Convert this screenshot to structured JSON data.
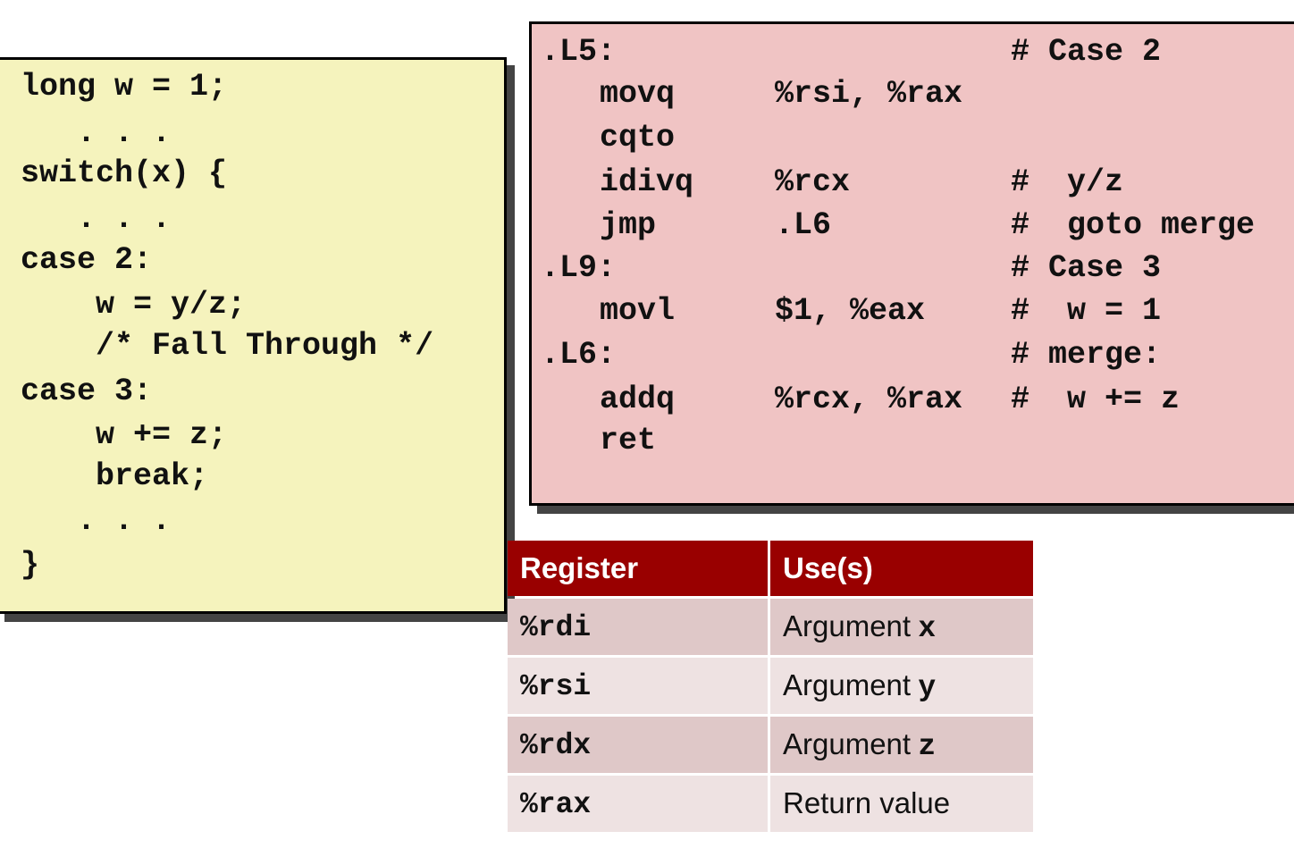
{
  "c_code": {
    "lines": [
      "long w = 1;",
      "   . . .",
      "switch(x) {",
      "   . . .",
      "case 2:",
      "    w = y/z;",
      "    /* Fall Through */",
      "case 3:",
      "    w += z;",
      "    break;",
      "   . . .",
      "}"
    ]
  },
  "assembly": {
    "lines": [
      {
        "label": ".L5:",
        "op": "",
        "args": "",
        "comment": "# Case 2"
      },
      {
        "label": "",
        "op": "movq",
        "args": "%rsi, %rax",
        "comment": ""
      },
      {
        "label": "",
        "op": "cqto",
        "args": "",
        "comment": ""
      },
      {
        "label": "",
        "op": "idivq",
        "args": "%rcx",
        "comment": "#  y/z"
      },
      {
        "label": "",
        "op": "jmp",
        "args": ".L6",
        "comment": "#  goto merge"
      },
      {
        "label": ".L9:",
        "op": "",
        "args": "",
        "comment": "# Case 3"
      },
      {
        "label": "",
        "op": "movl",
        "args": "$1, %eax",
        "comment": "#  w = 1"
      },
      {
        "label": ".L6:",
        "op": "",
        "args": "",
        "comment": "# merge:"
      },
      {
        "label": "",
        "op": "addq",
        "args": "%rcx, %rax",
        "comment": "#  w += z"
      },
      {
        "label": "",
        "op": "ret",
        "args": "",
        "comment": ""
      }
    ]
  },
  "register_table": {
    "headers": [
      "Register",
      "Use(s)"
    ],
    "rows": [
      {
        "register": "%rdi",
        "use": "Argument",
        "var": "x"
      },
      {
        "register": "%rsi",
        "use": "Argument",
        "var": "y"
      },
      {
        "register": "%rdx",
        "use": "Argument",
        "var": "z"
      },
      {
        "register": "%rax",
        "use": "Return value",
        "var": ""
      }
    ]
  },
  "colors": {
    "c_box_bg": "#f5f3bd",
    "asm_box_bg": "#f0c4c4",
    "table_header_bg": "#990000",
    "table_row_odd": "#dfc8c8",
    "table_row_even": "#eee2e2"
  }
}
